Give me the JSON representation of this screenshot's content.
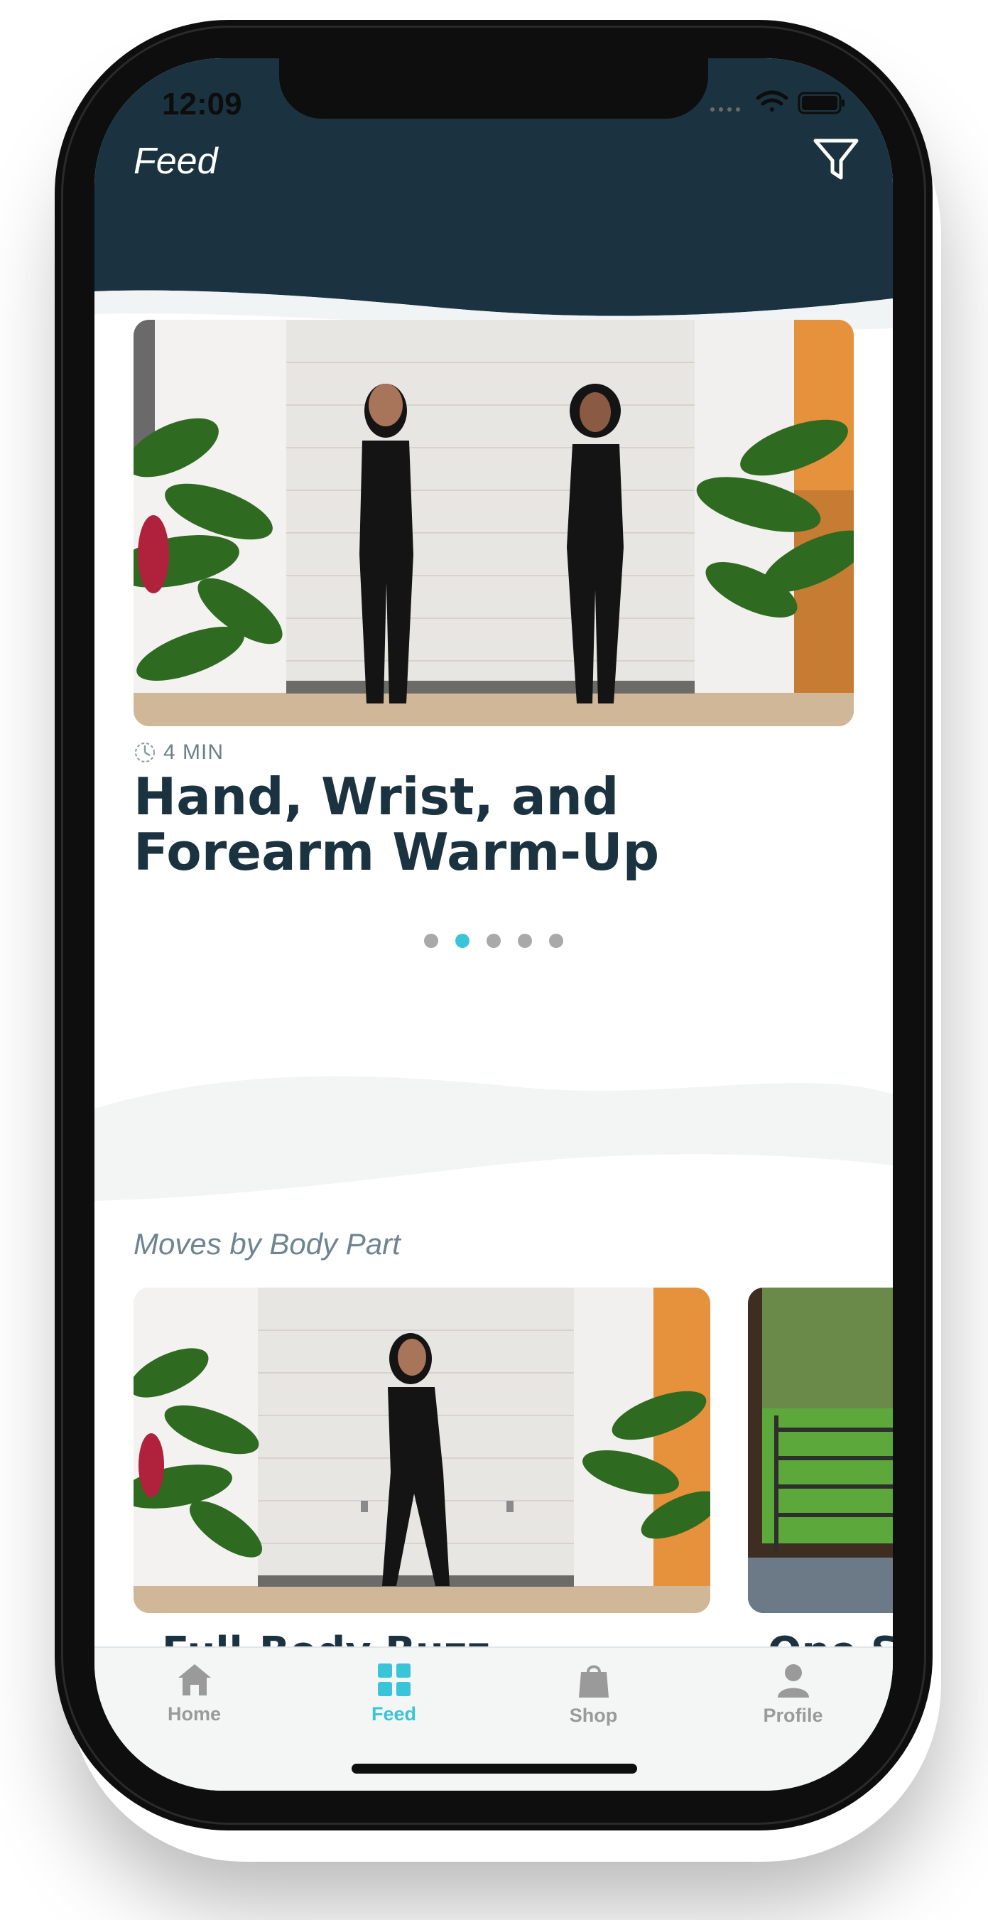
{
  "status_bar": {
    "time": "12:09"
  },
  "header": {
    "title": "Feed",
    "filter_icon": "filter-icon"
  },
  "hero": {
    "duration": "4 MIN",
    "title": "Hand, Wrist, and Forearm Warm-Up",
    "carousel_total": 5,
    "carousel_active": 2
  },
  "section": {
    "label": "Moves by Body Part",
    "cards": [
      {
        "title": "Full-Body Buzz"
      },
      {
        "title": "One Sp"
      }
    ]
  },
  "tabbar": {
    "tabs": [
      {
        "label": "Home",
        "icon": "house-icon",
        "active": false
      },
      {
        "label": "Feed",
        "icon": "grid-icon",
        "active": true
      },
      {
        "label": "Shop",
        "icon": "bag-icon",
        "active": false
      },
      {
        "label": "Profile",
        "icon": "person-icon",
        "active": false
      }
    ]
  },
  "colors": {
    "header_bg": "#1b3340",
    "accent": "#3ac4d8",
    "title_text": "#1b3340",
    "tab_inactive": "#9a9a9a"
  }
}
